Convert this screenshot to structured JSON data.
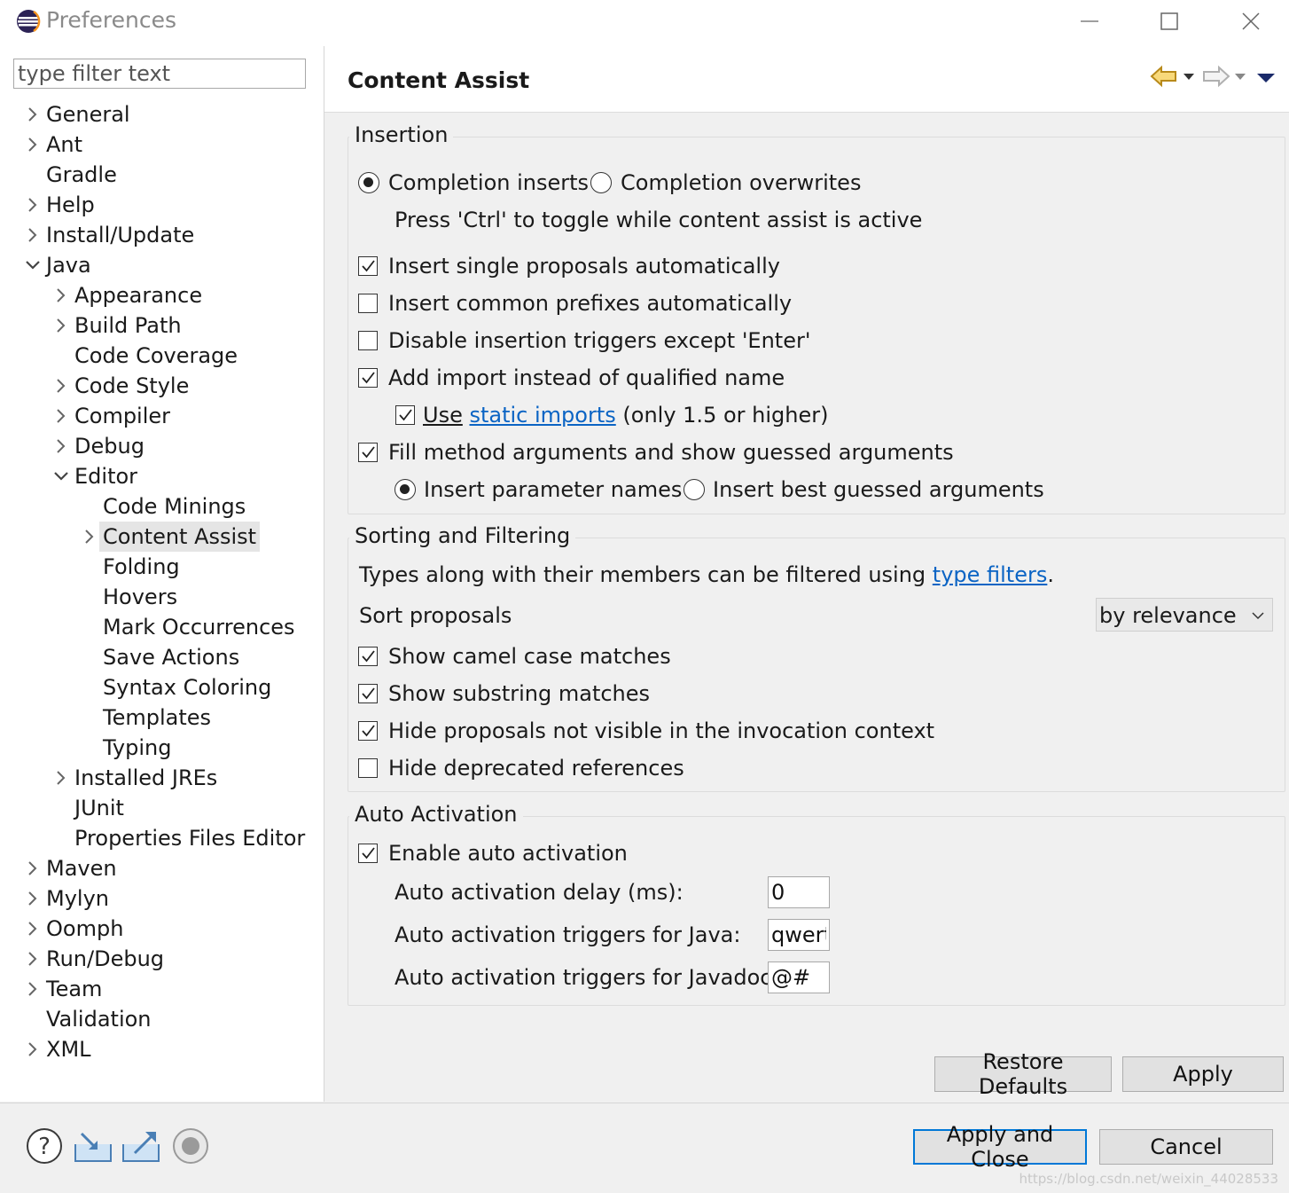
{
  "window": {
    "title": "Preferences",
    "controls": [
      "minimize",
      "maximize",
      "close"
    ]
  },
  "filter": {
    "placeholder": "type filter text",
    "value": "type filter text"
  },
  "tree": [
    {
      "label": "General",
      "level": 0,
      "state": "collapsed"
    },
    {
      "label": "Ant",
      "level": 0,
      "state": "collapsed"
    },
    {
      "label": "Gradle",
      "level": 0,
      "state": "leaf"
    },
    {
      "label": "Help",
      "level": 0,
      "state": "collapsed"
    },
    {
      "label": "Install/Update",
      "level": 0,
      "state": "collapsed"
    },
    {
      "label": "Java",
      "level": 0,
      "state": "expanded"
    },
    {
      "label": "Appearance",
      "level": 1,
      "state": "collapsed"
    },
    {
      "label": "Build Path",
      "level": 1,
      "state": "collapsed"
    },
    {
      "label": "Code Coverage",
      "level": 1,
      "state": "leaf"
    },
    {
      "label": "Code Style",
      "level": 1,
      "state": "collapsed"
    },
    {
      "label": "Compiler",
      "level": 1,
      "state": "collapsed"
    },
    {
      "label": "Debug",
      "level": 1,
      "state": "collapsed"
    },
    {
      "label": "Editor",
      "level": 1,
      "state": "expanded"
    },
    {
      "label": "Code Minings",
      "level": 2,
      "state": "leaf"
    },
    {
      "label": "Content Assist",
      "level": 2,
      "state": "collapsed",
      "selected": true
    },
    {
      "label": "Folding",
      "level": 2,
      "state": "leaf"
    },
    {
      "label": "Hovers",
      "level": 2,
      "state": "leaf"
    },
    {
      "label": "Mark Occurrences",
      "level": 2,
      "state": "leaf"
    },
    {
      "label": "Save Actions",
      "level": 2,
      "state": "leaf"
    },
    {
      "label": "Syntax Coloring",
      "level": 2,
      "state": "leaf"
    },
    {
      "label": "Templates",
      "level": 2,
      "state": "leaf"
    },
    {
      "label": "Typing",
      "level": 2,
      "state": "leaf"
    },
    {
      "label": "Installed JREs",
      "level": 1,
      "state": "collapsed"
    },
    {
      "label": "JUnit",
      "level": 1,
      "state": "leaf"
    },
    {
      "label": "Properties Files Editor",
      "level": 1,
      "state": "leaf"
    },
    {
      "label": "Maven",
      "level": 0,
      "state": "collapsed"
    },
    {
      "label": "Mylyn",
      "level": 0,
      "state": "collapsed"
    },
    {
      "label": "Oomph",
      "level": 0,
      "state": "collapsed"
    },
    {
      "label": "Run/Debug",
      "level": 0,
      "state": "collapsed"
    },
    {
      "label": "Team",
      "level": 0,
      "state": "collapsed"
    },
    {
      "label": "Validation",
      "level": 0,
      "state": "leaf"
    },
    {
      "label": "XML",
      "level": 0,
      "state": "collapsed"
    }
  ],
  "page": {
    "title": "Content Assist"
  },
  "insertion": {
    "title": "Insertion",
    "radio_inserts": "Completion inserts",
    "radio_overwrites": "Completion overwrites",
    "toggle_hint": "Press 'Ctrl' to toggle while content assist is active",
    "cb_single": "Insert single proposals automatically",
    "cb_prefixes": "Insert common prefixes automatically",
    "cb_disable_triggers": "Disable insertion triggers except 'Enter'",
    "cb_add_import": "Add import instead of qualified name",
    "static_use": "Use",
    "static_link": "static imports",
    "static_rest": "(only 1.5 or higher)",
    "cb_fill_args": "Fill method arguments and show guessed arguments",
    "radio_param_names": "Insert parameter names",
    "radio_best_guessed": "Insert best guessed arguments"
  },
  "sorting": {
    "title": "Sorting and Filtering",
    "types_text": "Types along with their members can be filtered using",
    "types_link": "type filters",
    "types_end": ".",
    "sort_label": "Sort proposals",
    "sort_value": "by relevance",
    "cb_camel": "Show camel case matches",
    "cb_substring": "Show substring matches",
    "cb_hide_invisible": "Hide proposals not visible in the invocation context",
    "cb_hide_deprecated": "Hide deprecated references"
  },
  "auto": {
    "title": "Auto Activation",
    "cb_enable": "Enable auto activation",
    "delay_label": "Auto activation delay (ms):",
    "delay_value": "0",
    "java_label": "Auto activation triggers for Java:",
    "java_value": "qwert",
    "javadoc_label": "Auto activation triggers for Javadoc:",
    "javadoc_value": "@#"
  },
  "buttons": {
    "restore": "Restore Defaults",
    "apply": "Apply",
    "apply_close": "Apply and Close",
    "cancel": "Cancel"
  },
  "checked": {
    "cb_single": true,
    "cb_prefixes": false,
    "cb_disable_triggers": false,
    "cb_add_import": true,
    "cb_static": true,
    "cb_fill_args": true,
    "cb_camel": true,
    "cb_substring": true,
    "cb_hide_invisible": true,
    "cb_hide_deprecated": false,
    "cb_enable": true
  },
  "watermark": "https://blog.csdn.net/weixin_44028533",
  "accent_color": "#0078d7",
  "link_color": "#0b64c4"
}
